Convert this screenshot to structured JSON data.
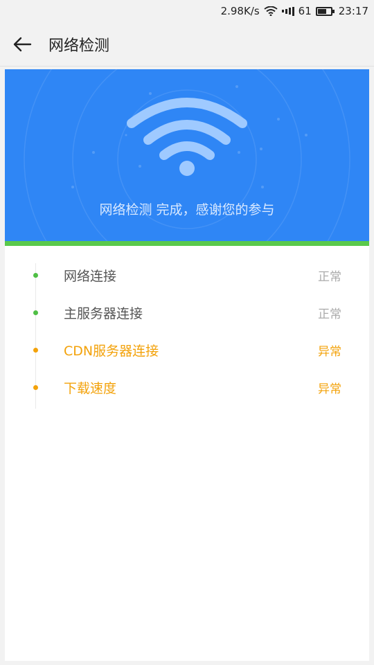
{
  "status_bar": {
    "speed": "2.98K/s",
    "battery": "61",
    "time": "23:17",
    "icons": [
      "wifi-icon",
      "signal-icon",
      "battery-icon"
    ]
  },
  "header": {
    "back_icon": "arrow-left-icon",
    "title": "网络检测"
  },
  "banner": {
    "message": "网络检测 完成，感谢您的参与",
    "icon": "wifi-icon",
    "color": "#2f86f5",
    "strip_color": "#5ac94b"
  },
  "checks": [
    {
      "label": "网络连接",
      "status": "正常",
      "state": "ok"
    },
    {
      "label": "主服务器连接",
      "status": "正常",
      "state": "ok"
    },
    {
      "label": "CDN服务器连接",
      "status": "异常",
      "state": "bad"
    },
    {
      "label": "下载速度",
      "status": "异常",
      "state": "bad"
    }
  ],
  "colors": {
    "ok": "#4fbf45",
    "bad": "#f3a20a"
  }
}
